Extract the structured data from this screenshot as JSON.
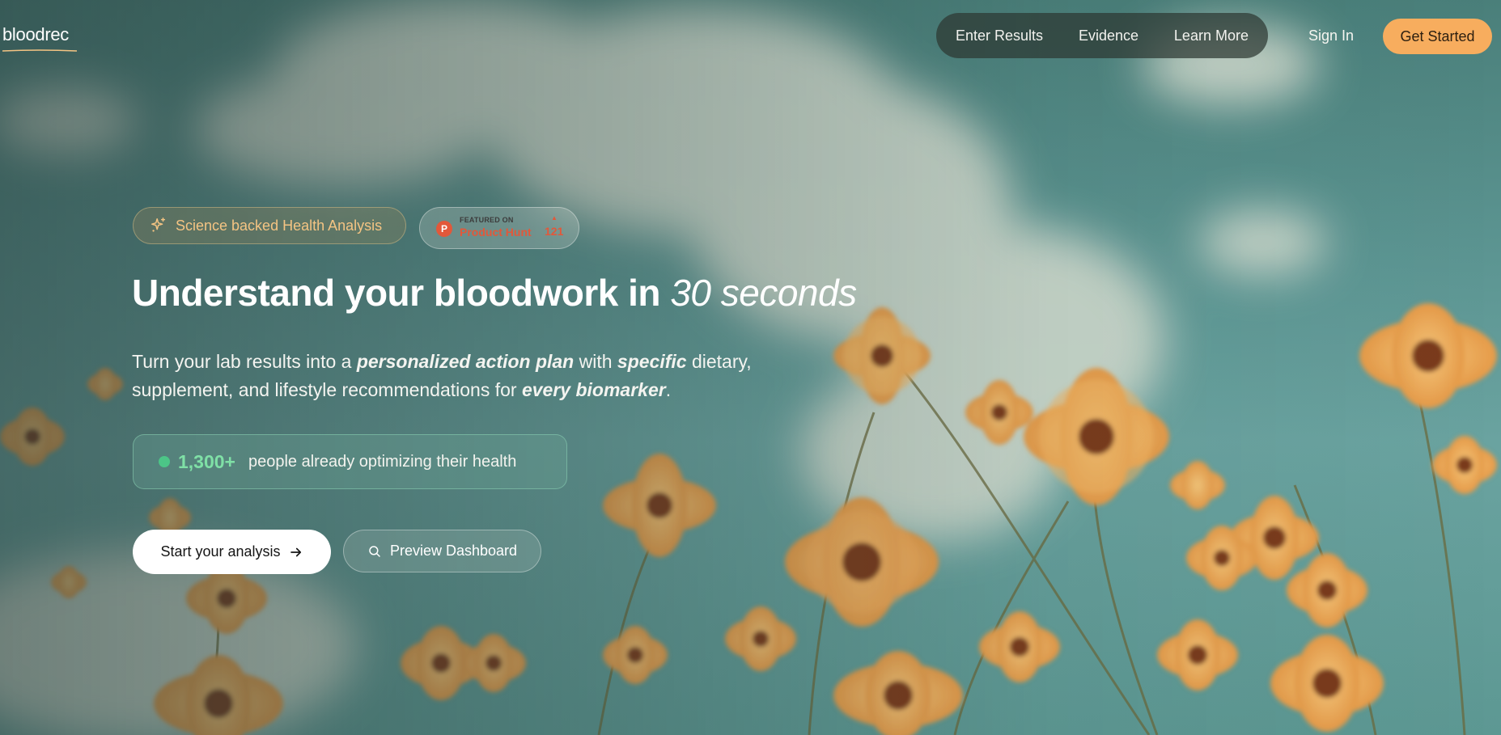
{
  "brand": {
    "logo_text": "bloodrec",
    "accent_color": "#f7ad5e",
    "success_color": "#7fe0a6"
  },
  "nav": {
    "links": [
      {
        "label": "Enter Results"
      },
      {
        "label": "Evidence"
      },
      {
        "label": "Learn More"
      }
    ],
    "sign_in_label": "Sign In",
    "get_started_label": "Get Started"
  },
  "hero": {
    "badge_science": {
      "icon": "sparkle-icon",
      "label": "Science backed Health Analysis"
    },
    "badge_producthunt": {
      "logo_letter": "P",
      "featured_text": "FEATURED ON",
      "name": "Product Hunt",
      "upvote_icon": "▲",
      "upvotes": "121"
    },
    "headline_main": "Understand your bloodwork in ",
    "headline_emphasis": "30 seconds",
    "subhead": {
      "part1": "Turn your lab results into a ",
      "em1": "personalized action plan",
      "part2": " with ",
      "em2": "specific",
      "part3": " dietary, supplement, and lifestyle recommendations for ",
      "em3": "every biomarker",
      "part4": "."
    },
    "social_proof": {
      "count": "1,300+",
      "text": "people already optimizing their health"
    },
    "cta_primary_label": "Start your analysis",
    "cta_primary_icon": "arrow-right-icon",
    "cta_secondary_label": "Preview Dashboard",
    "cta_secondary_icon": "search-icon"
  }
}
